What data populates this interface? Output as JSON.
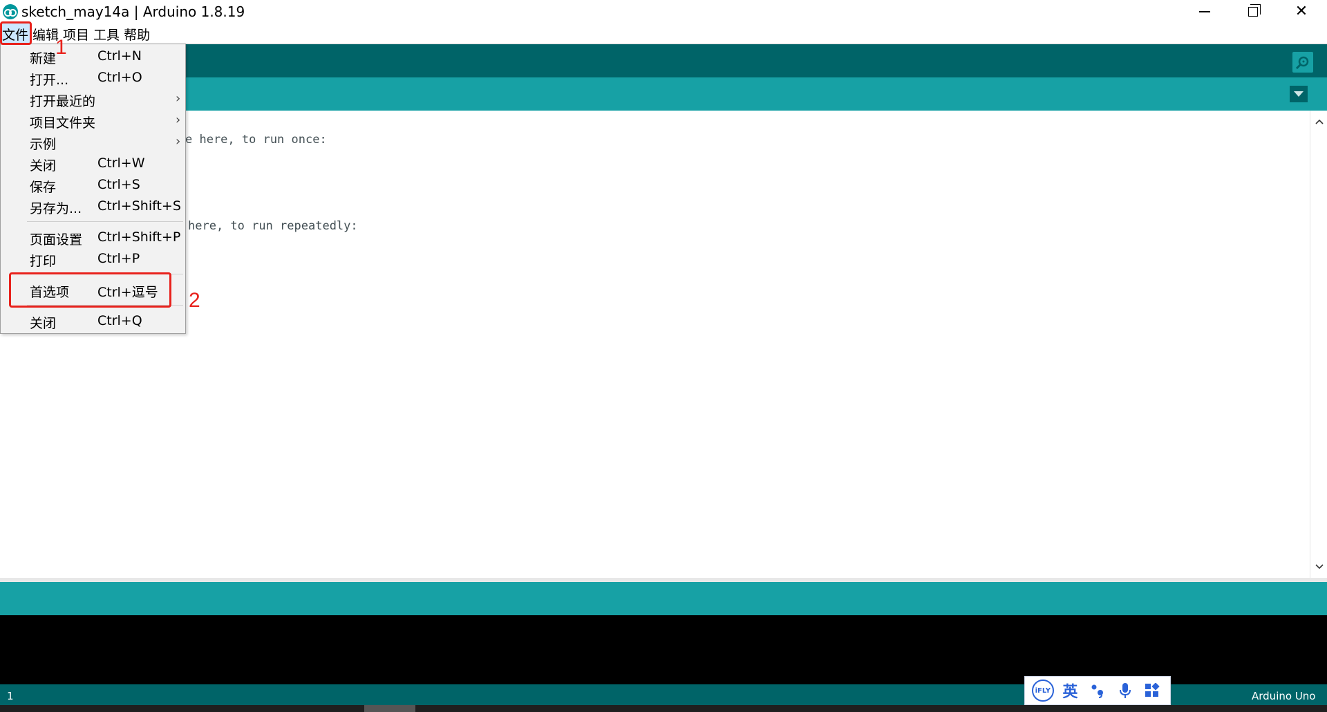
{
  "window": {
    "title": "sketch_may14a | Arduino 1.8.19"
  },
  "menubar": {
    "items": [
      "文件",
      "编辑",
      "项目",
      "工具",
      "帮助"
    ]
  },
  "editor": {
    "visible_lines": [
      "e here, to run once:",
      "here, to run repeatedly:"
    ]
  },
  "file_menu": {
    "items": [
      {
        "label": "新建",
        "shortcut": "Ctrl+N"
      },
      {
        "label": "打开...",
        "shortcut": "Ctrl+O"
      },
      {
        "label": "打开最近的",
        "shortcut": "",
        "submenu": true
      },
      {
        "label": "项目文件夹",
        "shortcut": "",
        "submenu": true
      },
      {
        "label": "示例",
        "shortcut": "",
        "submenu": true
      },
      {
        "label": "关闭",
        "shortcut": "Ctrl+W"
      },
      {
        "label": "保存",
        "shortcut": "Ctrl+S"
      },
      {
        "label": "另存为...",
        "shortcut": "Ctrl+Shift+S"
      },
      {
        "label": "页面设置",
        "shortcut": "Ctrl+Shift+P"
      },
      {
        "label": "打印",
        "shortcut": "Ctrl+P"
      },
      {
        "label": "首选项",
        "shortcut": "Ctrl+逗号"
      },
      {
        "label": "关闭",
        "shortcut": "Ctrl+Q"
      }
    ],
    "submenu_arrow": "›"
  },
  "annotations": {
    "step1": "1",
    "step2": "2",
    "color": "#e8221c"
  },
  "footer": {
    "line_number": "1",
    "board": "Arduino Uno"
  },
  "ime": {
    "logo": "iFLY",
    "lang": "英"
  },
  "colors": {
    "toolbar": "#006468",
    "tabbar": "#17a1a5",
    "console": "#000000"
  }
}
